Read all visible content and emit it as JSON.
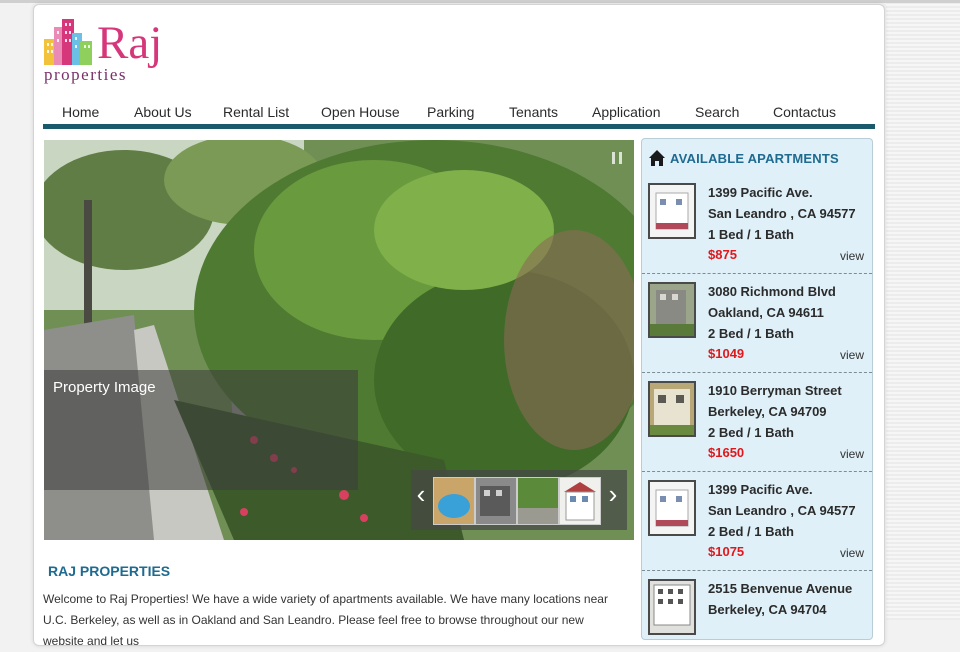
{
  "logo": {
    "name": "Raj",
    "subtitle": "properties"
  },
  "nav": {
    "items": [
      {
        "label": "Home"
      },
      {
        "label": "About Us"
      },
      {
        "label": "Rental List"
      },
      {
        "label": "Open House"
      },
      {
        "label": "Parking"
      },
      {
        "label": "Tenants"
      },
      {
        "label": "Application"
      },
      {
        "label": "Search"
      },
      {
        "label": "Contactus"
      }
    ]
  },
  "slider": {
    "caption": "Property Image",
    "prev_icon": "chevron-left-icon",
    "next_icon": "chevron-right-icon",
    "pause_icon": "pause-icon"
  },
  "welcome": {
    "title": "RAJ PROPERTIES",
    "text": "Welcome to Raj Properties! We have a wide variety of apartments available. We have many locations near U.C. Berkeley, as well as in Oakland and San Leandro. Please feel free to browse throughout our new website and let us"
  },
  "sidebar": {
    "title": "AVAILABLE APARTMENTS",
    "icon": "home-icon",
    "listings": [
      {
        "address": "1399 Pacific Ave.",
        "city": "San Leandro , CA 94577",
        "beds": "1 Bed / 1 Bath",
        "price": "$875",
        "view": "view"
      },
      {
        "address": "3080 Richmond Blvd",
        "city": "Oakland, CA 94611",
        "beds": "2 Bed / 1 Bath",
        "price": "$1049",
        "view": "view"
      },
      {
        "address": "1910 Berryman Street",
        "city": "Berkeley, CA 94709",
        "beds": "2 Bed / 1 Bath",
        "price": "$1650",
        "view": "view"
      },
      {
        "address": "1399 Pacific Ave.",
        "city": "San Leandro , CA 94577",
        "beds": "2 Bed / 1 Bath",
        "price": "$1075",
        "view": "view"
      },
      {
        "address": "2515 Benvenue Avenue",
        "city": "Berkeley, CA 94704",
        "beds": "",
        "price": "",
        "view": ""
      }
    ]
  },
  "colors": {
    "accent_blue": "#1e6a90",
    "nav_bar": "#1b5a6c",
    "price_red": "#e0181b",
    "logo_pink": "#d6367a",
    "sidebar_bg": "#dff0f8"
  }
}
